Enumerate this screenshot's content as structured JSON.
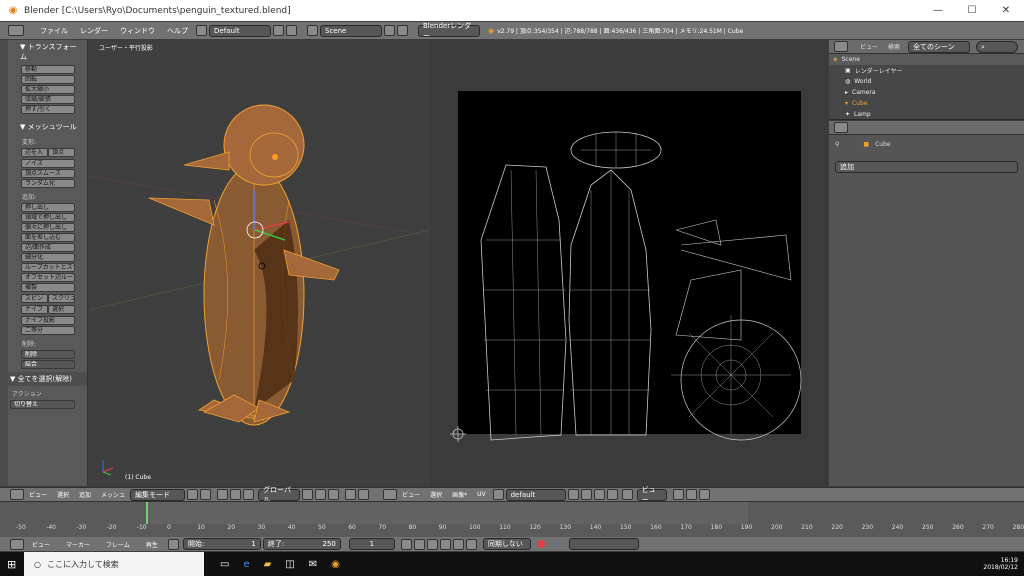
{
  "window": {
    "title": "Blender  [C:\\Users\\Ryo\\Documents\\penguin_textured.blend]",
    "minimize": "—",
    "maximize": "☐",
    "close": "✕"
  },
  "menu": {
    "items": [
      "ファイル",
      "レンダー",
      "ウィンドウ",
      "ヘルプ"
    ],
    "layout": "Default",
    "scene": "Scene",
    "engine": "Blenderレンダー",
    "stats": "v2.79 | 頂点:354/354 | 辺:788/788 | 面:436/436 | 三角面:704 | メモリ:24.51M | Cube"
  },
  "toolshelf": {
    "transform_header": "▼ トランスフォーム",
    "transform": [
      "移動",
      "回転",
      "拡大縮小",
      "収縮/膨張",
      "押す/引く"
    ],
    "mesh_header": "▼ メッシュツール",
    "deform_label": "変形:",
    "deform": [
      "辺を入",
      "頂点",
      "ノイズ",
      "頂点スムーズ",
      "ランダム化"
    ],
    "add_label": "追加:",
    "add": [
      "押し出し",
      "領域で押し出し",
      "個々に押し出し",
      "面を差し込む",
      "辺/面作成",
      "細分化",
      "ループカットとスライド",
      "オフセット辺ループ",
      "複製",
      "スピン",
      "スクリュー",
      "ナイフ",
      "選択",
      "ナイフ投影",
      "二等分"
    ],
    "delete_label": "削除:",
    "delete": "削除",
    "merge": "結合",
    "select_all": "▼ 全てを選択(解除)",
    "action_label": "アクション",
    "action": "切り替え"
  },
  "view3d": {
    "label": "ユーザー・平行投影",
    "object": "(1) Cube"
  },
  "outliner": {
    "menu": [
      "ビュー",
      "検索"
    ],
    "scenes": "全てのシーン",
    "rows": [
      "Scene",
      "レンダーレイヤー",
      "World",
      "Camera",
      "Cube",
      "Lamp"
    ]
  },
  "properties": {
    "object": "Cube",
    "add": "追加"
  },
  "header3d": {
    "items": [
      "ビュー",
      "選択",
      "追加",
      "メッシュ"
    ],
    "mode": "編集モード",
    "orient": "グローバル"
  },
  "headeruv": {
    "items": [
      "ビュー",
      "選択",
      "画像*",
      "UV"
    ],
    "image": "default",
    "view": "ビュー"
  },
  "timeline": {
    "ticks": [
      "-50",
      "-40",
      "-30",
      "-20",
      "-10",
      "0",
      "10",
      "20",
      "30",
      "40",
      "50",
      "60",
      "70",
      "80",
      "90",
      "100",
      "110",
      "120",
      "130",
      "140",
      "150",
      "160",
      "170",
      "180",
      "190",
      "200",
      "210",
      "220",
      "230",
      "240",
      "250",
      "260",
      "270",
      "280"
    ],
    "current": 1
  },
  "tlbar": {
    "items": [
      "ビュー",
      "マーカー",
      "フレーム",
      "再生"
    ],
    "start": "開始:",
    "start_val": "1",
    "end": "終了:",
    "end_val": "250",
    "frame": "1",
    "sync": "同期しない"
  },
  "taskbar": {
    "search": "ここに入力して検索",
    "time": "16:19",
    "date": "2018/02/12"
  },
  "colors": {
    "accent": "#e87d0d",
    "selected": "#f0a030"
  }
}
